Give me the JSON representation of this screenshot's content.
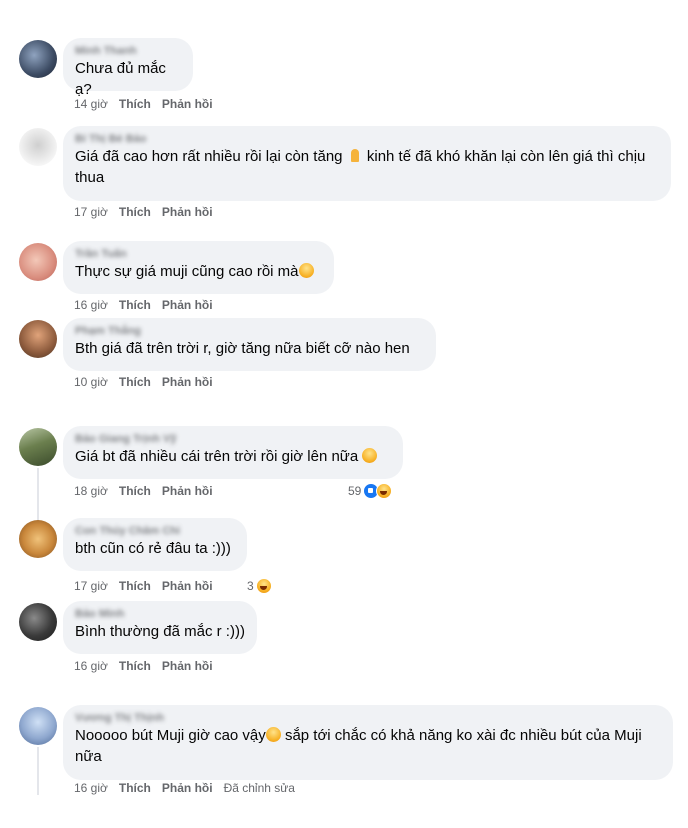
{
  "actions": {
    "like": "Thích",
    "reply": "Phản hồi",
    "edited": "Đã chỉnh sửa"
  },
  "comments": [
    {
      "name": "Minh Thanh",
      "text": "Chưa đủ mắc ạ?",
      "time": "14 giờ"
    },
    {
      "name": "Bí Thị Bé Bảo",
      "text_a": "Giá đã cao hơn rất nhiều rồi lại còn tăng",
      "text_b": "kinh tế đã khó khăn lại còn lên giá thì chịu thua",
      "time": "17 giờ"
    },
    {
      "name": "Trần Tuấn",
      "text": "Thực sự giá muji cũng cao rồi mà",
      "time": "16 giờ"
    },
    {
      "name": "Phạm Thắng",
      "text": "Bth giá đã trên trời r, giờ tăng nữa biết cỡ nào hen",
      "time": "10 giờ"
    },
    {
      "name": "Bảo Giang Trịnh Vỹ",
      "text": "Giá bt đã nhiều cái trên trời rồi giờ lên nữa",
      "time": "18 giờ",
      "reactions": "59"
    },
    {
      "name": "Con Thúy Châm Chi",
      "text": "bth cũn có rẻ đâu ta :)))",
      "time": "17 giờ",
      "reactions": "3"
    },
    {
      "name": "Bảo Minh",
      "text": "Bình thường đã mắc r :)))",
      "time": "16 giờ"
    },
    {
      "name": "Vương Thị Thịnh",
      "text_a": "Nooooo bút Muji giờ cao vậy",
      "text_b": "sắp tới chắc có khả năng ko xài đc nhiều bút của Muji nữa",
      "time": "16 giờ"
    }
  ],
  "colors": {
    "bubble": "#f0f2f5",
    "meta": "#65676b",
    "like": "#1877f2"
  },
  "icons": [
    "pray-emoji",
    "cry-emoji",
    "laugh-emoji",
    "like-reaction",
    "haha-reaction",
    "scream-emoji"
  ]
}
